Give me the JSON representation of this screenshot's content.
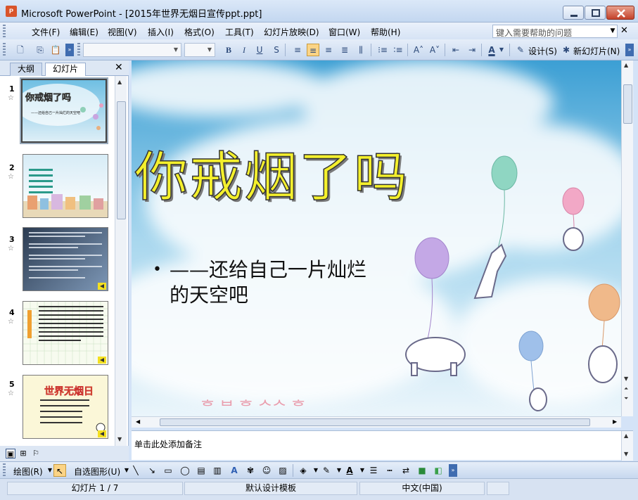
{
  "window": {
    "title": "Microsoft PowerPoint - [2015年世界无烟日宣传ppt.ppt]",
    "app_icon_text": "P"
  },
  "menu": {
    "items": [
      "文件(F)",
      "编辑(E)",
      "视图(V)",
      "插入(I)",
      "格式(O)",
      "工具(T)",
      "幻灯片放映(D)",
      "窗口(W)",
      "帮助(H)"
    ],
    "help_placeholder": "键入需要帮助的问题"
  },
  "toolbar": {
    "design_label": "设计(S)",
    "new_slide_label": "新幻灯片(N)"
  },
  "left_pane": {
    "tabs": [
      "大纲",
      "幻灯片"
    ],
    "slides": [
      {
        "num": "1",
        "title": "你戒烟了吗",
        "subtitle": "——还给自己一片灿烂的天空吧"
      },
      {
        "num": "2"
      },
      {
        "num": "3"
      },
      {
        "num": "4"
      },
      {
        "num": "5",
        "title": "世界无烟日"
      }
    ]
  },
  "slide": {
    "title": "你戒烟了吗",
    "bullet_line1": "——还给自己一片灿烂",
    "bullet_line2": "的天空吧"
  },
  "notes": {
    "placeholder": "单击此处添加备注"
  },
  "drawing_toolbar": {
    "draw_label": "绘图(R)",
    "autoshapes_label": "自选图形(U)"
  },
  "status": {
    "slide_position": "幻灯片 1 / 7",
    "template": "默认设计模板",
    "language": "中文(中国)"
  },
  "colors": {
    "title_fill": "#f4f02c",
    "sky": "#4fa8d6",
    "chrome": "#d4e3f7"
  }
}
